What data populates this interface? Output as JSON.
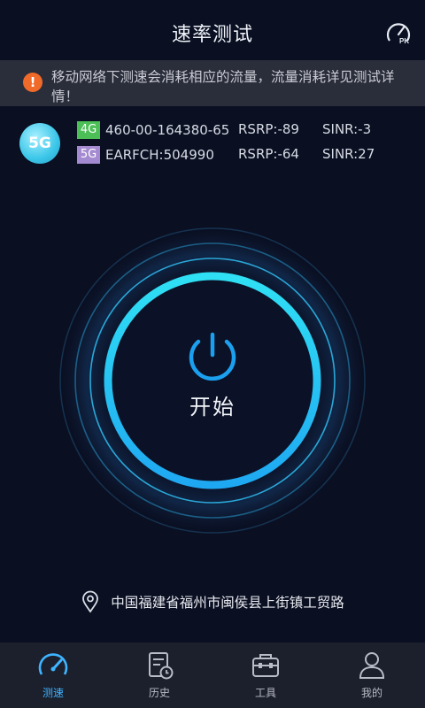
{
  "header": {
    "title": "速率测试",
    "pk_icon": "pk-speedometer-icon"
  },
  "notice": {
    "icon": "warning-icon",
    "text": "移动网络下测速会消耗相应的流量，流量消耗详见测试详情！"
  },
  "network": {
    "badge": "5G",
    "rows": [
      {
        "tag": "4G",
        "id": "460-00-164380-65",
        "rsrp": "RSRP:-89",
        "sinr": "SINR:-3"
      },
      {
        "tag": "5G",
        "id": "EARFCH:504990",
        "rsrp": "RSRP:-64",
        "sinr": "SINR:27"
      }
    ]
  },
  "start": {
    "label": "开始",
    "icon": "power-icon"
  },
  "location": {
    "icon": "location-pin-icon",
    "text": "中国福建省福州市闽侯县上街镇工贸路"
  },
  "tabs": [
    {
      "label": "测速",
      "icon": "speedometer-icon",
      "active": true
    },
    {
      "label": "历史",
      "icon": "history-icon",
      "active": false
    },
    {
      "label": "工具",
      "icon": "toolbox-icon",
      "active": false
    },
    {
      "label": "我的",
      "icon": "user-icon",
      "active": false
    }
  ],
  "colors": {
    "accent": "#3fb4ff",
    "ring": "#22d4f0",
    "warning": "#f06a2a",
    "background": "#0a0f22"
  }
}
